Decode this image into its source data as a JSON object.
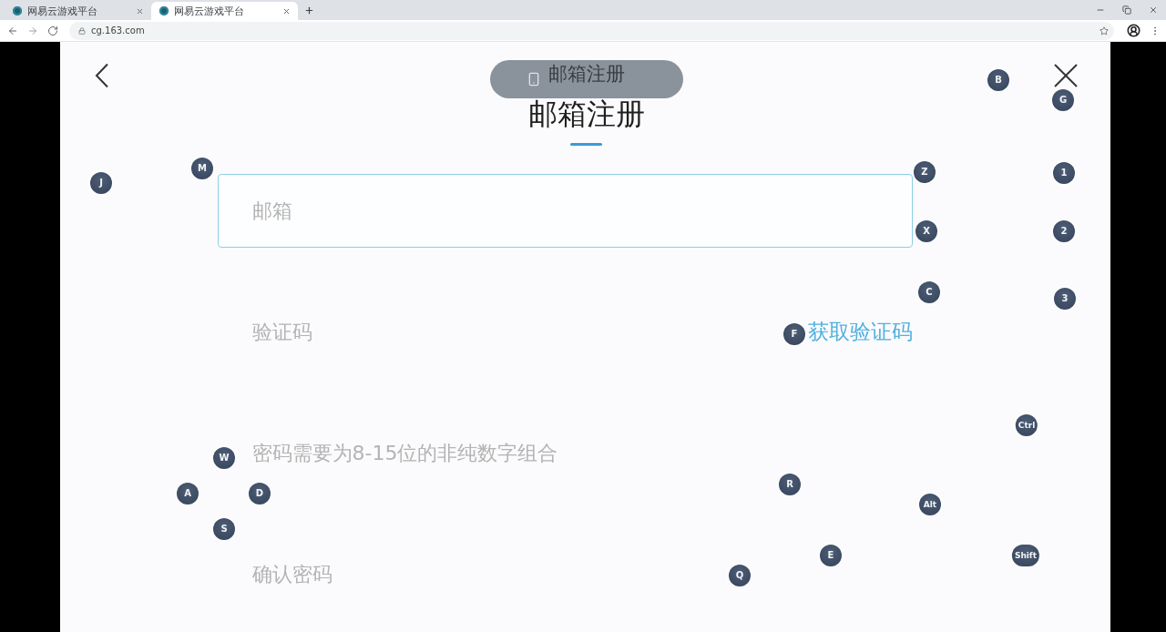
{
  "browser": {
    "tabs": [
      {
        "title": "网易云游戏平台",
        "selected": false
      },
      {
        "title": "网易云游戏平台",
        "selected": true
      }
    ],
    "address": "cg.163.com"
  },
  "page": {
    "toast": {
      "overlapping_title": "邮箱注册"
    },
    "title": "邮箱注册",
    "fields": [
      {
        "kind": "text",
        "placeholder": "邮箱",
        "focused": true
      },
      {
        "kind": "code",
        "placeholder": "验证码",
        "focused": false,
        "action": "获取验证码"
      },
      {
        "kind": "text",
        "placeholder": "密码需要为8-15位的非纯数字组合",
        "focused": false
      },
      {
        "kind": "text",
        "placeholder": "确认密码",
        "focused": false
      }
    ]
  },
  "key_hints": [
    "B",
    "G",
    "M",
    "Z",
    "1",
    "J",
    "X",
    "2",
    "C",
    "3",
    "F",
    "Ctrl",
    "W",
    "R",
    "A",
    "D",
    "Alt",
    "S",
    "E",
    "Shift",
    "Q"
  ]
}
